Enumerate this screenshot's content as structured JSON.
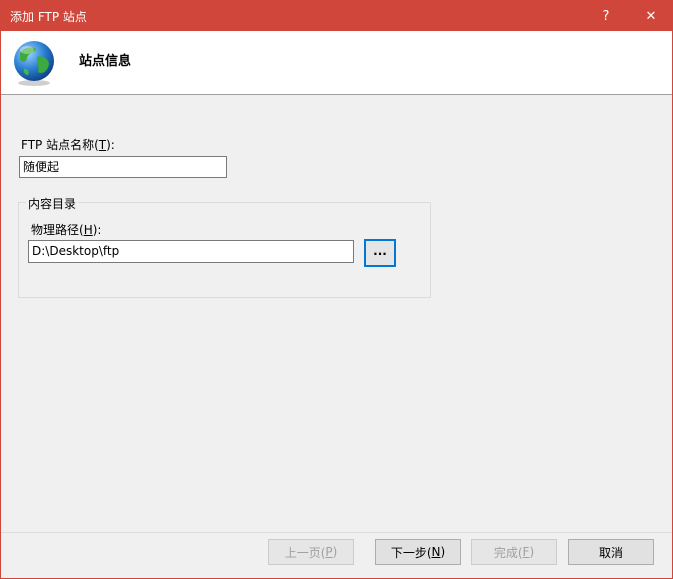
{
  "window": {
    "title": "添加 FTP 站点",
    "help_glyph": "?",
    "close_glyph": "✕"
  },
  "header": {
    "title": "站点信息"
  },
  "site_name": {
    "label_prefix": "FTP 站点名称(",
    "label_key": "T",
    "label_suffix": "):",
    "value": "随便起"
  },
  "content_dir": {
    "legend": "内容目录",
    "path_label_prefix": "物理路径(",
    "path_label_key": "H",
    "path_label_suffix": "):",
    "path_value": "D:\\Desktop\\ftp",
    "browse_label": "..."
  },
  "footer": {
    "prev": {
      "text": "上一页(",
      "key": "P",
      "end": ")",
      "enabled": false
    },
    "next": {
      "text": "下一步(",
      "key": "N",
      "end": ")",
      "enabled": true
    },
    "finish": {
      "text": "完成(",
      "key": "F",
      "end": ")",
      "enabled": false
    },
    "cancel": {
      "text": "取消",
      "enabled": true
    }
  },
  "colors": {
    "titlebar": "#d0463a",
    "focus_border": "#0078d7"
  },
  "icons": {
    "header": "globe-icon"
  }
}
